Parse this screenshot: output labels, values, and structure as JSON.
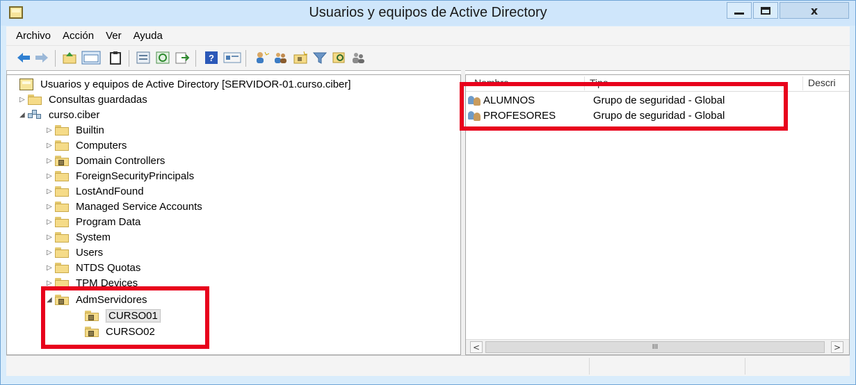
{
  "window": {
    "title": "Usuarios y equipos de Active Directory",
    "controls": {
      "minimize": "",
      "maximize": "",
      "close": "x"
    }
  },
  "menu": [
    "Archivo",
    "Acción",
    "Ver",
    "Ayuda"
  ],
  "toolbar": {
    "icons": [
      "back-icon",
      "forward-icon",
      "up-folder-icon",
      "console-tree-icon",
      "clipboard-icon",
      "properties-icon",
      "refresh-icon",
      "export-icon",
      "help-icon",
      "details-icon",
      "new-user-icon",
      "new-group-icon",
      "new-ou-icon",
      "filter-icon",
      "find-icon",
      "add-to-group-icon"
    ]
  },
  "tree": {
    "root": "Usuarios y equipos de Active Directory [SERVIDOR-01.curso.ciber]",
    "items": [
      {
        "label": "Consultas guardadas",
        "expander": "▷"
      },
      {
        "label": "curso.ciber",
        "expander": "◢"
      },
      {
        "label": "Builtin",
        "expander": "▷"
      },
      {
        "label": "Computers",
        "expander": "▷"
      },
      {
        "label": "Domain Controllers",
        "expander": "▷"
      },
      {
        "label": "ForeignSecurityPrincipals",
        "expander": "▷"
      },
      {
        "label": "LostAndFound",
        "expander": "▷"
      },
      {
        "label": "Managed Service Accounts",
        "expander": "▷"
      },
      {
        "label": "Program Data",
        "expander": "▷"
      },
      {
        "label": "System",
        "expander": "▷"
      },
      {
        "label": "Users",
        "expander": "▷"
      },
      {
        "label": "NTDS Quotas",
        "expander": "▷"
      },
      {
        "label": "TPM Devices",
        "expander": "▷"
      },
      {
        "label": "AdmServidores",
        "expander": "◢"
      },
      {
        "label": "CURSO01",
        "expander": ""
      },
      {
        "label": "CURSO02",
        "expander": ""
      }
    ]
  },
  "list": {
    "columns": [
      "Nombre",
      "Tipo",
      "Descri"
    ],
    "rows": [
      {
        "name": "ALUMNOS",
        "type": "Grupo de seguridad - Global"
      },
      {
        "name": "PROFESORES",
        "type": "Grupo de seguridad - Global"
      }
    ],
    "scroll": {
      "left": "<",
      "right": ">",
      "thumb": "III"
    }
  },
  "colors": {
    "highlight": "#e8001c",
    "titlebar": "#cfe6fb",
    "folder": "#f5db88"
  }
}
